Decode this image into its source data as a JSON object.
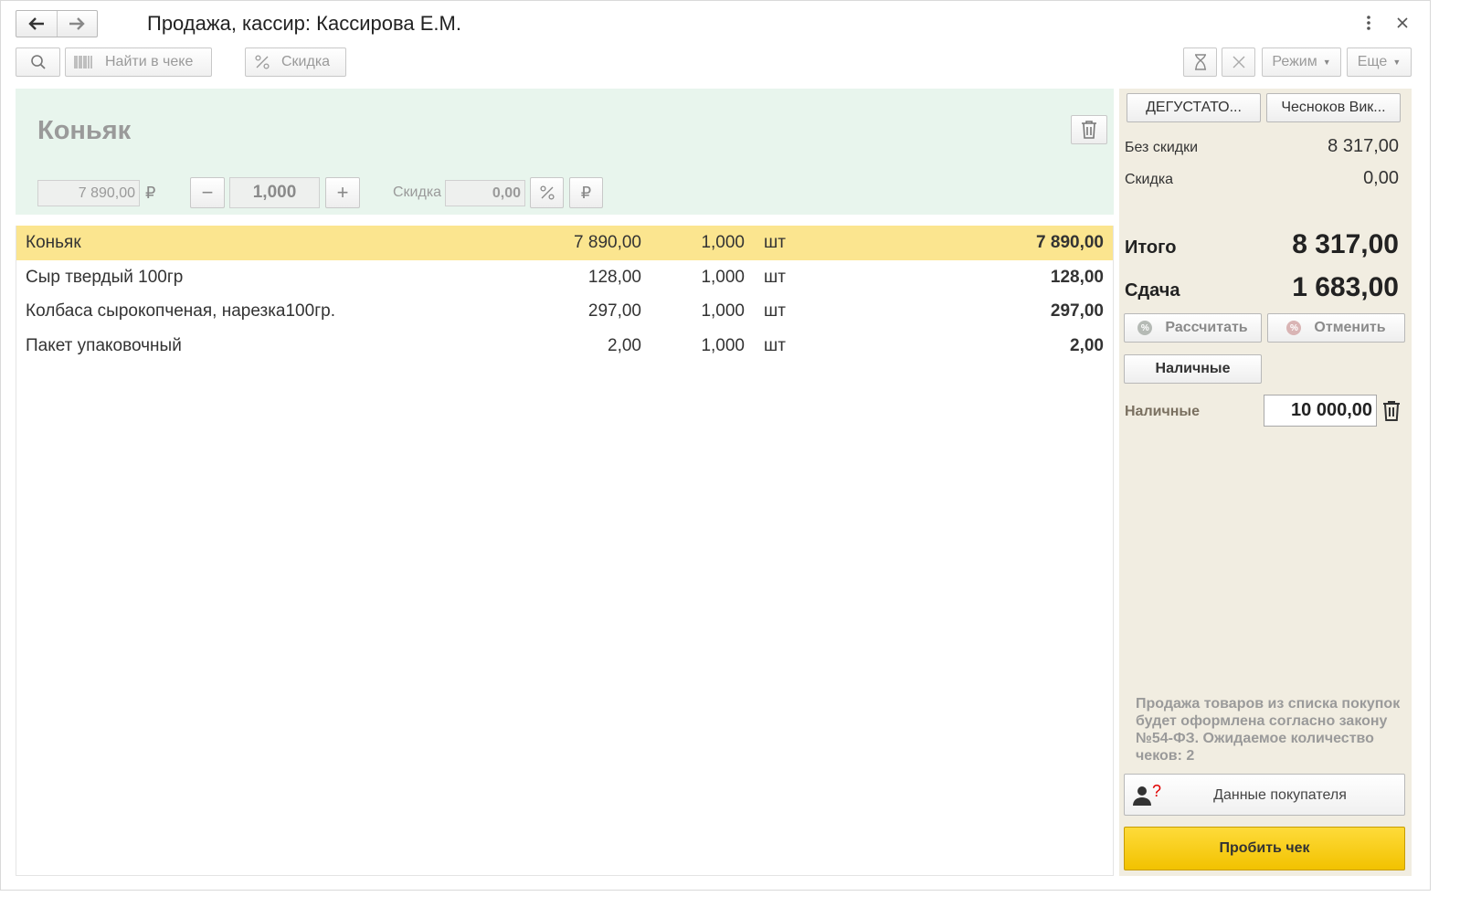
{
  "window": {
    "title": "Продажа, кассир: Кассирова Е.М.",
    "nav": {
      "back_icon": "arrow-left-icon",
      "forward_icon": "arrow-right-icon"
    },
    "menu_icon": "more-vertical-icon",
    "close_icon": "close-icon"
  },
  "toolbar": {
    "search_icon": "search-icon",
    "find_in_check": "Найти в чеке",
    "discount": "Скидка",
    "mode": "Режим",
    "more": "Еще"
  },
  "product": {
    "name": "Коньяк",
    "price": "7 890,00",
    "currency": "₽",
    "quantity": "1,000",
    "discount_label": "Скидка",
    "discount_value": "0,00",
    "percent_symbol": "%",
    "minus": "−",
    "plus": "+"
  },
  "items": [
    {
      "name": "Коньяк",
      "price": "7 890,00",
      "qty": "1,000",
      "unit": "шт",
      "sum": "7 890,00",
      "selected": true
    },
    {
      "name": "Сыр твердый 100гр",
      "price": "128,00",
      "qty": "1,000",
      "unit": "шт",
      "sum": "128,00",
      "selected": false
    },
    {
      "name": "Колбаса сырокопченая, нарезка100гр.",
      "price": "297,00",
      "qty": "1,000",
      "unit": "шт",
      "sum": "297,00",
      "selected": false
    },
    {
      "name": "Пакет упаковочный",
      "price": "2,00",
      "qty": "1,000",
      "unit": "шт",
      "sum": "2,00",
      "selected": false
    }
  ],
  "side": {
    "btn_tasting": "ДЕГУСТАТО...",
    "btn_person": "Чесноков Вик...",
    "without_discount_label": "Без скидки",
    "without_discount_value": "8 317,00",
    "discount_label": "Скидка",
    "discount_value": "0,00",
    "total_label": "Итого",
    "total_value": "8 317,00",
    "change_label": "Сдача",
    "change_value": "1 683,00",
    "calculate": "Рассчитать",
    "cancel": "Отменить",
    "cash_button": "Наличные",
    "cash_label": "Наличные",
    "cash_value": "10 000,00",
    "note": "Продажа товаров из списка покупок будет оформлена согласно закону №54-ФЗ. Ожидаемое количество чеков: 2",
    "buyer_data": "Данные покупателя",
    "buyer_question": "?",
    "print_check": "Пробить чек"
  },
  "colors": {
    "selected_row": "#fbe58f",
    "product_panel": "#e8f5ed",
    "side_panel": "#f1ede1",
    "print_button": "#f7cd1c"
  }
}
